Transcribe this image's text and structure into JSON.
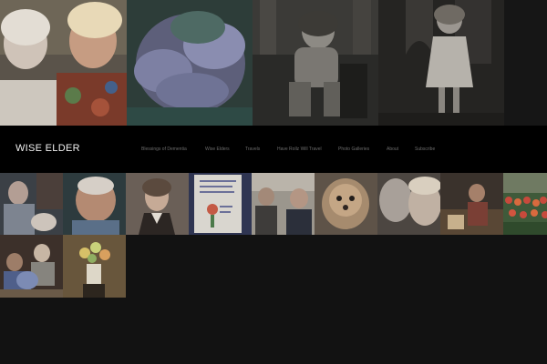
{
  "site": {
    "title": "WISE ELDER"
  },
  "nav": {
    "items": [
      {
        "label": "Blessings of Dementia"
      },
      {
        "label": "Wise Elders"
      },
      {
        "label": "Travels"
      },
      {
        "label": "Have Rollz Will Travel"
      },
      {
        "label": "Photo Galleries"
      },
      {
        "label": "About"
      },
      {
        "label": "Subscribe"
      }
    ]
  },
  "colors": {
    "page_background": "#121212",
    "header_background": "#000000",
    "title_text": "#f2f2f2",
    "nav_text": "#6c6c6c"
  }
}
